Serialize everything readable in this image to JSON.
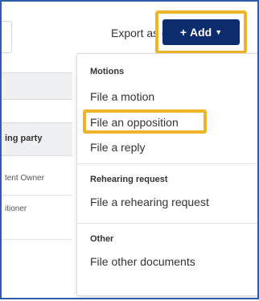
{
  "toolbar": {
    "export_label": "Export as csv",
    "add_label": "Add"
  },
  "table": {
    "header": "ing party",
    "rows": [
      "tent Owner",
      "itioner"
    ]
  },
  "menu": {
    "sections": [
      {
        "title": "Motions",
        "items": [
          "File a motion",
          "File an opposition",
          "File a reply"
        ]
      },
      {
        "title": "Rehearing request",
        "items": [
          "File a rehearing request"
        ]
      },
      {
        "title": "Other",
        "items": [
          "File other documents"
        ]
      }
    ],
    "highlighted_item": "File an opposition"
  },
  "colors": {
    "add_button": "#0c2c6e",
    "highlight": "#f0b428",
    "frame_border": "#2f5ea8"
  },
  "icons": {
    "download": "download-icon",
    "caret": "caret-down-icon"
  }
}
